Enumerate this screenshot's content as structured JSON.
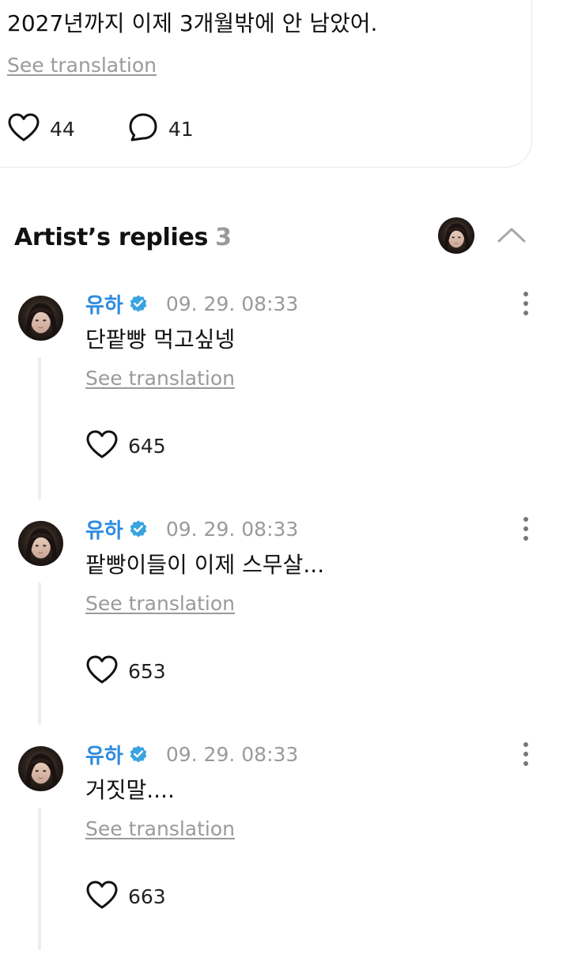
{
  "post": {
    "text": "2027년까지 이제 3개월밖에 안 남았어.",
    "translate_label": "See translation",
    "likes": "44",
    "comments": "41"
  },
  "replies_header": {
    "title": "Artist’s replies",
    "count": "3"
  },
  "replies": [
    {
      "author": "유하",
      "time": "09. 29. 08:33",
      "text": "단팥빵 먹고싶넹",
      "translate_label": "See translation",
      "likes": "645"
    },
    {
      "author": "유하",
      "time": "09. 29. 08:33",
      "text": "팥빵이들이 이제 스무살...",
      "translate_label": "See translation",
      "likes": "653"
    },
    {
      "author": "유하",
      "time": "09. 29. 08:33",
      "text": "거짓말....",
      "translate_label": "See translation",
      "likes": "663"
    }
  ],
  "colors": {
    "author_name": "#2d8bde",
    "verified_badge": "#3aa3e0",
    "muted_text": "#9a9a9a",
    "thread_line": "#ededed"
  },
  "icons": [
    "heart-icon",
    "comment-bubble-icon",
    "verified-badge-icon",
    "chevron-up-icon",
    "more-vertical-icon",
    "avatar-image"
  ]
}
